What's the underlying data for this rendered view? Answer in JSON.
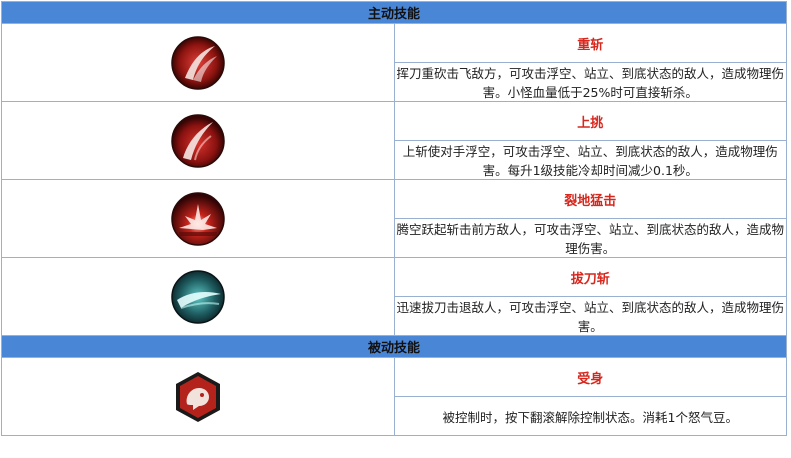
{
  "active_section": {
    "title": "主动技能"
  },
  "active_skills": [
    {
      "name": "重斩",
      "icon": "heavy-slash-icon",
      "description": "挥刀重砍击飞敌方，可攻击浮空、站立、到底状态的敌人，造成物理伤害。小怪血量低于25%时可直接斩杀。"
    },
    {
      "name": "上挑",
      "icon": "upward-slash-icon",
      "description": "上斩使对手浮空，可攻击浮空、站立、到底状态的敌人，造成物理伤害。每升1级技能冷却时间减少0.1秒。"
    },
    {
      "name": "裂地猛击",
      "icon": "ground-smash-icon",
      "description": "腾空跃起斩击前方敌人，可攻击浮空、站立、到底状态的敌人，造成物理伤害。"
    },
    {
      "name": "拔刀斩",
      "icon": "blade-draw-icon",
      "description": "迅速拔刀击退敌人，可攻击浮空、站立、到底状态的敌人，造成物理伤害。"
    }
  ],
  "passive_section": {
    "title": "被动技能"
  },
  "passive_skills": [
    {
      "name": "受身",
      "icon": "break-fall-icon",
      "description": "被控制时，按下翻滚解除控制状态。消耗1个怒气豆。"
    }
  ],
  "colors": {
    "header_bg": "#4a86d6",
    "skill_name": "#d6281e",
    "border": "#9ab0d0",
    "icon_red": "#a31a16"
  }
}
